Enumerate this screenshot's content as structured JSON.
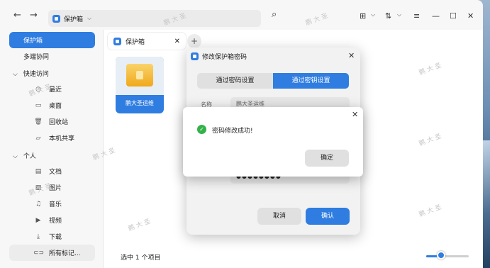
{
  "window": {
    "address_label": "保护箱",
    "tab_label": "保护箱",
    "status_text": "选中 1 个项目"
  },
  "sidebar": {
    "items": [
      {
        "label": "保护箱"
      },
      {
        "label": "多端协同"
      },
      {
        "label": "快速访问"
      },
      {
        "label": "最近"
      },
      {
        "label": "桌面"
      },
      {
        "label": "回收站"
      },
      {
        "label": "本机共享"
      },
      {
        "label": "个人"
      },
      {
        "label": "文档"
      },
      {
        "label": "图片"
      },
      {
        "label": "音乐"
      },
      {
        "label": "视频"
      },
      {
        "label": "下载"
      },
      {
        "label": "所有标记..."
      }
    ]
  },
  "file": {
    "name": "鹏大圣运维"
  },
  "dialog_change": {
    "title": "修改保护箱密码",
    "tab_password": "通过密码设置",
    "tab_key": "通过密钥设置",
    "field1_label": "名称",
    "field1_value": "鹏大圣运维",
    "field2_value": "●●●●●●●●",
    "cancel": "取消",
    "confirm": "确认"
  },
  "dialog_success": {
    "message": "密码修改成功!",
    "ok": "确定"
  },
  "watermark": "鹏 大 圣",
  "colors": {
    "accent": "#2f7de1",
    "success": "#34b24a"
  }
}
